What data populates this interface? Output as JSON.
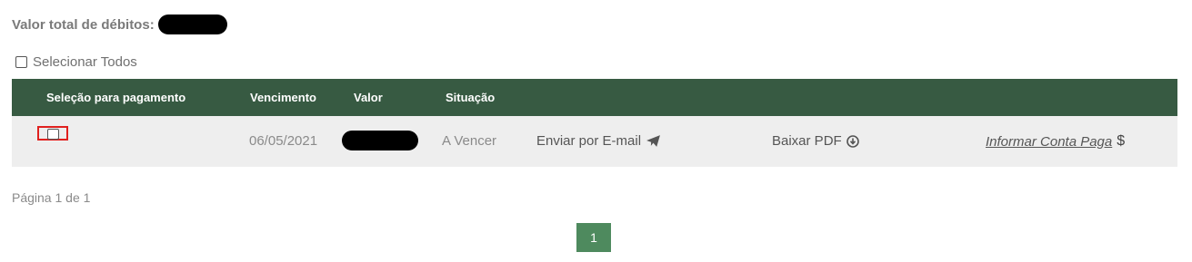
{
  "total": {
    "label": "Valor total de débitos:"
  },
  "select_all": {
    "label": "Selecionar Todos"
  },
  "table": {
    "headers": [
      "Seleção para pagamento",
      "Vencimento",
      "Valor",
      "Situação"
    ],
    "rows": [
      {
        "vencimento": "06/05/2021",
        "situacao": "A Vencer",
        "email_label": "Enviar por E-mail",
        "pdf_label": "Baixar PDF",
        "paid_label": "Informar Conta Paga ",
        "paid_symbol": "$"
      }
    ]
  },
  "pagination": {
    "info": "Página 1 de 1",
    "current": "1"
  },
  "colors": {
    "header_bg": "#375a42",
    "row_bg": "#eeeeee",
    "pager_bg": "#4e8a5e",
    "highlight": "#e0201e"
  },
  "icons": {
    "email": "paper-plane-icon",
    "pdf": "download-circle-icon"
  }
}
